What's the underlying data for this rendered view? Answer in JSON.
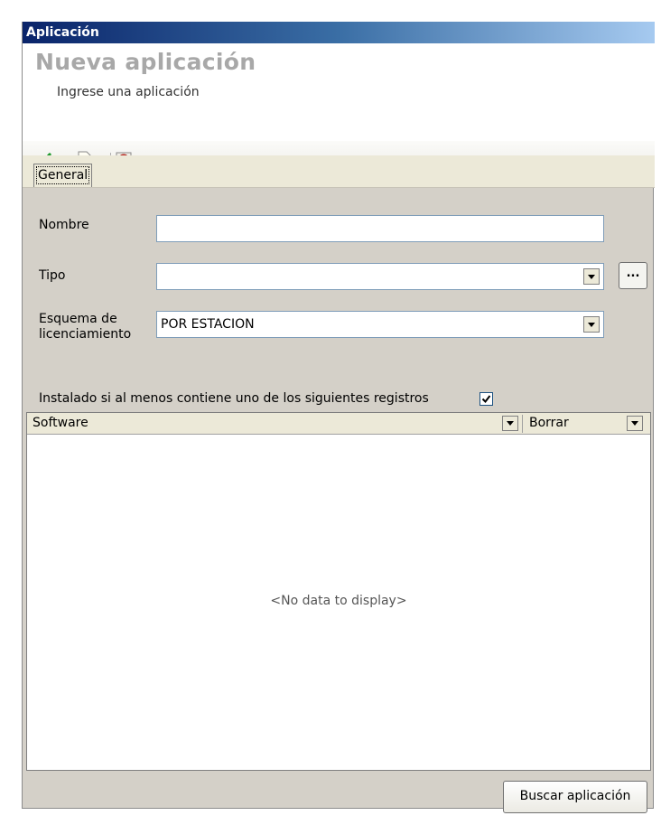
{
  "window": {
    "title": "Aplicación"
  },
  "header": {
    "title": "Nueva aplicación",
    "subtitle": "Ingrese una aplicación"
  },
  "toolbar": {
    "icons": [
      "accept-check-icon",
      "discard-document-icon",
      "close-red-icon"
    ]
  },
  "tabs": [
    {
      "label": "General",
      "selected": true
    }
  ],
  "form": {
    "nombre": {
      "label": "Nombre",
      "value": ""
    },
    "tipo": {
      "label": "Tipo",
      "value": "",
      "ellipsis_label": "..."
    },
    "esquema": {
      "label_line1": "Esquema de",
      "label_line2": "licenciamiento",
      "value": "POR ESTACION"
    },
    "instalado": {
      "label": "Instalado si al menos contiene uno de los siguientes registros",
      "checked": true
    }
  },
  "grid": {
    "columns": [
      "Software",
      "Borrar"
    ],
    "empty_text": "<No data to display>"
  },
  "actions": {
    "search_label": "Buscar aplicación"
  },
  "colors": {
    "title_gradient_start": "#0a246a",
    "title_gradient_end": "#a6caf0",
    "header_title": "#a8a8a8",
    "panel_bg": "#d4d0c8"
  }
}
